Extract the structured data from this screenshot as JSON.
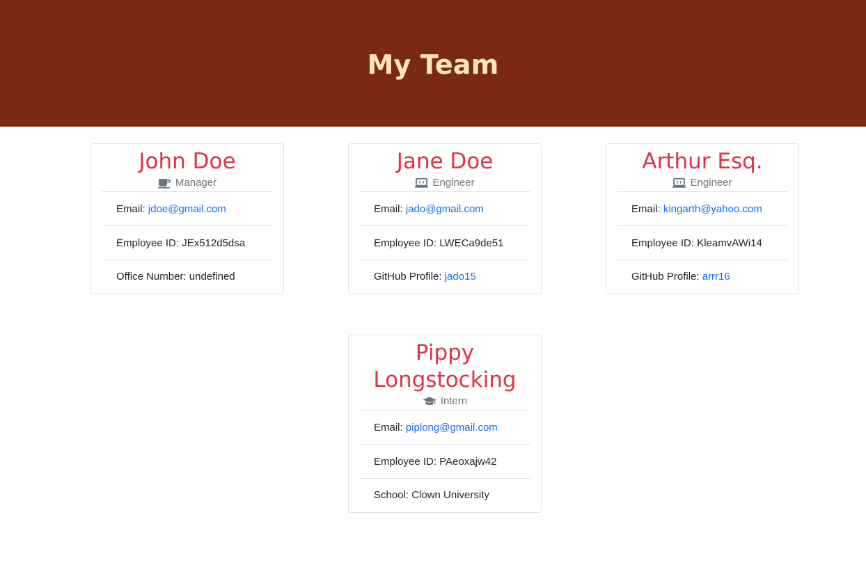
{
  "page": {
    "title": "My Team"
  },
  "colors": {
    "header_bg": "#7b2a12",
    "header_text": "#ffe6bf",
    "name": "#dc3545",
    "role": "#6c757d",
    "link": "#0d6efd"
  },
  "cards": [
    {
      "name": "John Doe",
      "role": "Manager",
      "role_icon": "mug-icon",
      "email_label": "Email: ",
      "email": "jdoe@gmail.com",
      "id_text": "Employee ID: JEx512d5dsa",
      "extra_label": "Office Number: undefined",
      "extra_link": ""
    },
    {
      "name": "Jane Doe",
      "role": "Engineer",
      "role_icon": "laptop-code-icon",
      "email_label": "Email: ",
      "email": "jado@gmail.com",
      "id_text": "Employee ID: LWECa9de51",
      "extra_label": "GitHub Profile: ",
      "extra_link": "jado15"
    },
    {
      "name": "Arthur Esq.",
      "role": "Engineer",
      "role_icon": "laptop-code-icon",
      "email_label": "Email: ",
      "email": "kingarth@yahoo.com",
      "id_text": "Employee ID: KleamvAWi14",
      "extra_label": "GitHub Profile: ",
      "extra_link": "arrr16"
    },
    {
      "name_line1": "Pippy",
      "name_line2": "Longstocking",
      "role": "Intern",
      "role_icon": "graduation-cap-icon",
      "email_label": "Email: ",
      "email": "piplong@gmail.com",
      "id_text": "Employee ID: PAeoxajw42",
      "extra_label": "School: Clown University",
      "extra_link": ""
    }
  ]
}
